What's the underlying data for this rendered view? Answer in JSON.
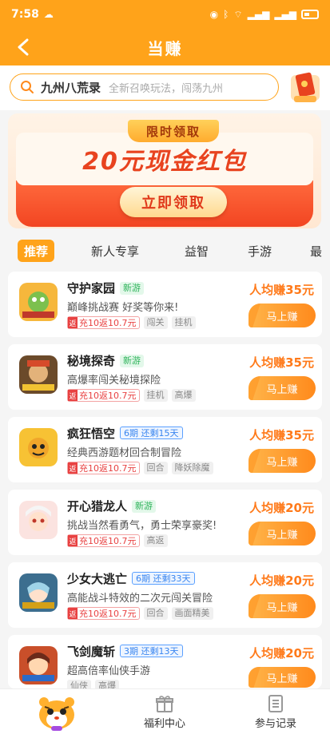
{
  "status": {
    "time": "7:58"
  },
  "header": {
    "title": "当赚"
  },
  "search": {
    "query": "九州八荒录",
    "placeholder": "全新召唤玩法，闯荡九州"
  },
  "banner": {
    "tag": "限时领取",
    "headline": "20元现金红包",
    "button_label": "立即领取"
  },
  "tabs": [
    "推荐",
    "新人专享",
    "益智",
    "手游",
    "最"
  ],
  "rebate_prefix": "返",
  "games": [
    {
      "name": "守护家园",
      "badge": "新游",
      "badge_type": "new",
      "desc": "巅峰挑战赛 好奖等你来!",
      "rebate": "充10返10.7元",
      "tags": [
        "闯关",
        "挂机"
      ],
      "earn": "人均赚35元",
      "button": "马上赚"
    },
    {
      "name": "秘境探奇",
      "badge": "新游",
      "badge_type": "new",
      "desc": "高爆率闯关秘境探险",
      "rebate": "充10返10.7元",
      "tags": [
        "挂机",
        "高爆"
      ],
      "earn": "人均赚35元",
      "button": "马上赚"
    },
    {
      "name": "疯狂悟空",
      "badge": "6期  还剩15天",
      "badge_type": "period",
      "desc": "经典西游题材回合制冒险",
      "rebate": "充10返10.7元",
      "tags": [
        "回合",
        "降妖除魔"
      ],
      "earn": "人均赚35元",
      "button": "马上赚"
    },
    {
      "name": "开心猎龙人",
      "badge": "新游",
      "badge_type": "new",
      "desc": "挑战当然看勇气，勇士荣享豪奖!",
      "rebate": "充10返10.7元",
      "tags": [
        "高返"
      ],
      "earn": "人均赚20元",
      "button": "马上赚"
    },
    {
      "name": "少女大逃亡",
      "badge": "6期  还剩33天",
      "badge_type": "period",
      "desc": "高能战斗特效的二次元闯关冒险",
      "rebate": "充10返10.7元",
      "tags": [
        "回合",
        "画面精美"
      ],
      "earn": "人均赚20元",
      "button": "马上赚"
    },
    {
      "name": "飞剑魔斩",
      "badge": "3期  还剩13天",
      "badge_type": "period",
      "desc": "超高倍率仙侠手游",
      "rebate": "",
      "tags": [
        "仙侠",
        "高爆"
      ],
      "earn": "人均赚20元",
      "button": "马上赚"
    }
  ],
  "bottom_nav": [
    {
      "label": "福利中心",
      "icon": "gift-icon"
    },
    {
      "label": "参与记录",
      "icon": "document-icon"
    }
  ],
  "colors": {
    "primary": "#ffa31a",
    "earn": "#ff7a1a",
    "rebate": "#e84141",
    "new_badge": "#2fb35b",
    "period_badge": "#3a86f0"
  }
}
